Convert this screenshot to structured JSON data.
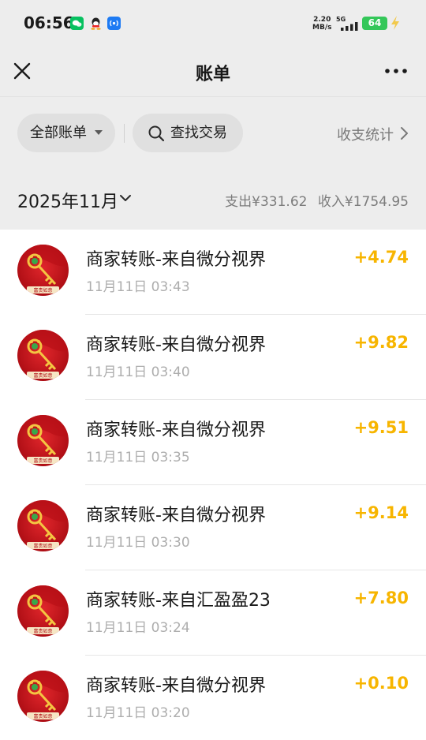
{
  "status_bar": {
    "time": "06:56",
    "net_speed_value": "2.20",
    "net_speed_unit": "MB/s",
    "network": "5G",
    "battery": "64",
    "app_icons": [
      "wechat-icon",
      "qq-icon",
      "nfc-icon"
    ]
  },
  "nav": {
    "title": "账单",
    "close_icon": "close-icon",
    "more_icon": "more-icon"
  },
  "filters": {
    "all_bills": "全部账单",
    "search": "查找交易",
    "stats": "收支统计"
  },
  "summary": {
    "month": "2025年11月",
    "expense": "支出¥331.62",
    "income": "收入¥1754.95"
  },
  "transactions": [
    {
      "title": "商家转账-来自微分视界",
      "time": "11月11日 03:43",
      "amount": "+4.74"
    },
    {
      "title": "商家转账-来自微分视界",
      "time": "11月11日 03:40",
      "amount": "+9.82"
    },
    {
      "title": "商家转账-来自微分视界",
      "time": "11月11日 03:35",
      "amount": "+9.51"
    },
    {
      "title": "商家转账-来自微分视界",
      "time": "11月11日 03:30",
      "amount": "+9.14"
    },
    {
      "title": "商家转账-来自汇盈盈23",
      "time": "11月11日 03:24",
      "amount": "+7.80"
    },
    {
      "title": "商家转账-来自微分视界",
      "time": "11月11日 03:20",
      "amount": "+0.10"
    }
  ],
  "colors": {
    "income_amount": "#f7b500",
    "background": "#ededed",
    "list_background": "#ffffff",
    "avatar_red": "#d3141c"
  }
}
